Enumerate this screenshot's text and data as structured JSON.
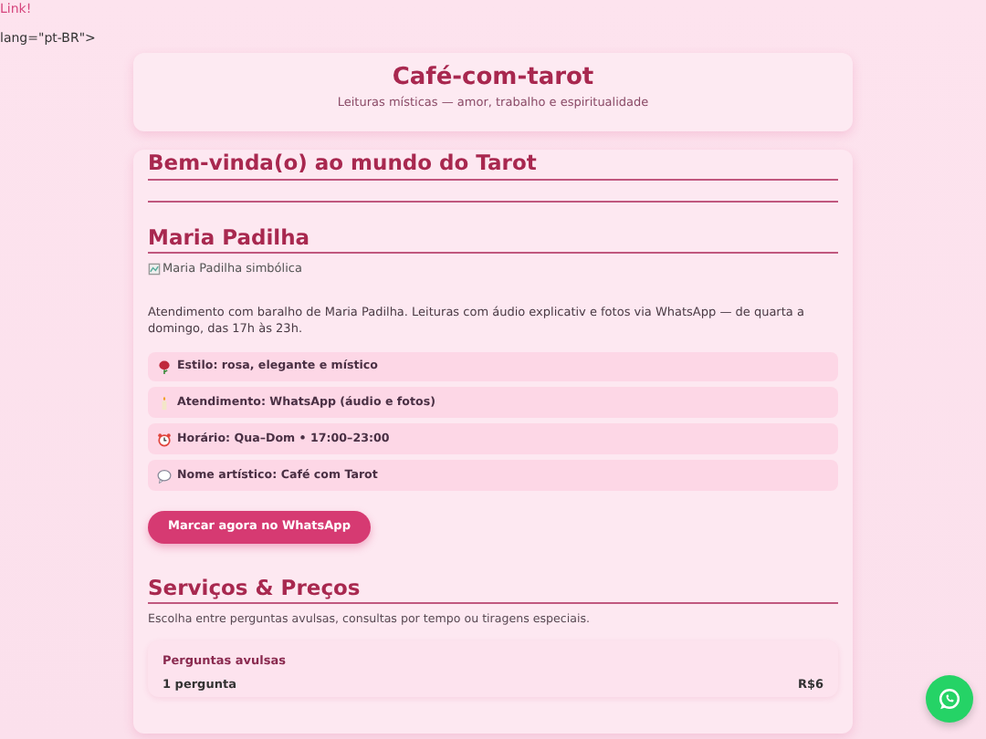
{
  "stray_text": [
    {
      "kind": "link",
      "text": "Link!"
    },
    {
      "kind": "plain",
      "text": "lang=\"pt-BR\">"
    }
  ],
  "header": {
    "title": "Café-com-tarot",
    "subtitle": "Leituras místicas — amor, trabalho e espiritualidade"
  },
  "welcome": {
    "heading": "Bem-vinda(o) ao mundo do Tarot"
  },
  "profile": {
    "heading": "Maria Padilha",
    "image_alt": "Maria Padilha simbólica",
    "description": "Atendimento com baralho de Maria Padilha. Leituras com áudio explicativ e fotos via WhatsApp — de quarta a domingo, das 17h às 23h.",
    "details": [
      {
        "kind": "style",
        "text": "Estilo: rosa, elegante e místico"
      },
      {
        "kind": "service",
        "text": "Atendimento: WhatsApp (áudio e fotos)"
      },
      {
        "kind": "hours",
        "text": "Horário: Qua–Dom • 17:00–23:00"
      },
      {
        "kind": "name",
        "text": "Nome artístico: Café com Tarot"
      }
    ],
    "button": "Marcar agora no WhatsApp"
  },
  "services": {
    "heading": "Serviços & Preços",
    "intro": "Escolha entre perguntas avulsas, consultas por tempo ou tiragens especiais.",
    "groups": [
      {
        "title": "Perguntas avulsas",
        "items": [
          {
            "label": "1 pergunta",
            "price": "R$6"
          }
        ]
      }
    ]
  }
}
